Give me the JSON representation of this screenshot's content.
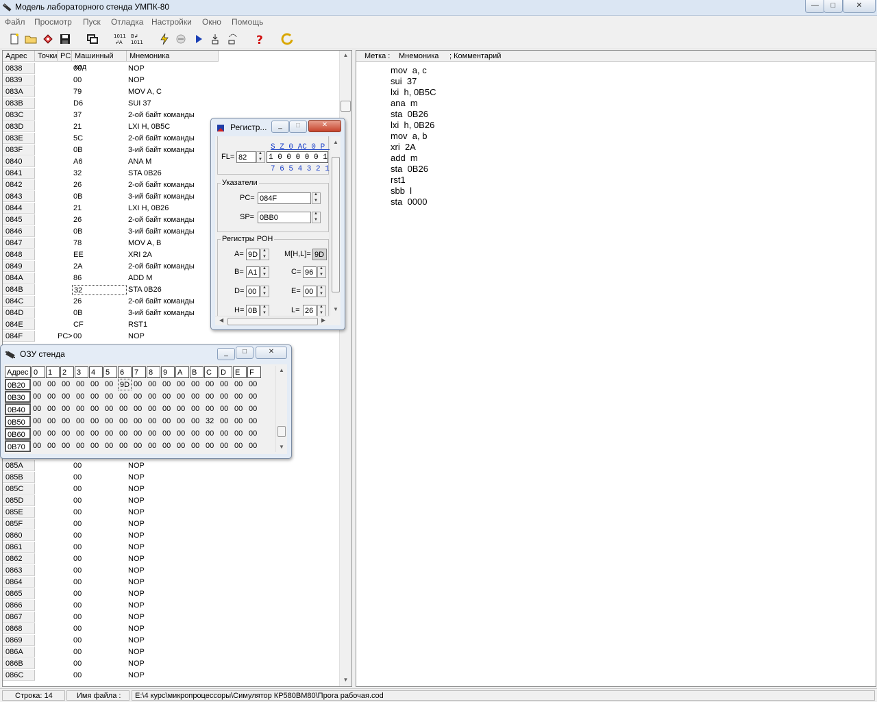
{
  "window": {
    "title": "Модель лабораторного стенда УМПК-80",
    "min": "—",
    "max": "□",
    "close": "✕"
  },
  "menu": [
    "Файл",
    "Просмотр",
    "Пуск",
    "Отладка",
    "Настройки",
    "Окно",
    "Помощь"
  ],
  "code_table": {
    "headers": {
      "addr": "Адрес",
      "breakpoints": "Точки",
      "pc": "PC",
      "machine_code": "Машинный код",
      "mnemonic": "Мнемоника"
    },
    "rows_top": [
      {
        "addr": "0838",
        "pc": "",
        "code": "00",
        "mn": "NOP"
      },
      {
        "addr": "0839",
        "pc": "",
        "code": "00",
        "mn": "NOP"
      },
      {
        "addr": "083A",
        "pc": "",
        "code": "79",
        "mn": "MOV  A, C"
      },
      {
        "addr": "083B",
        "pc": "",
        "code": "D6",
        "mn": "SUI  37"
      },
      {
        "addr": "083C",
        "pc": "",
        "code": "37",
        "mn": "2-ой байт команды"
      },
      {
        "addr": "083D",
        "pc": "",
        "code": "21",
        "mn": "LXI  H, 0B5C"
      },
      {
        "addr": "083E",
        "pc": "",
        "code": "5C",
        "mn": "2-ой байт команды"
      },
      {
        "addr": "083F",
        "pc": "",
        "code": "0B",
        "mn": "3-ий байт команды"
      },
      {
        "addr": "0840",
        "pc": "",
        "code": "A6",
        "mn": "ANA  M"
      },
      {
        "addr": "0841",
        "pc": "",
        "code": "32",
        "mn": "STA  0B26"
      },
      {
        "addr": "0842",
        "pc": "",
        "code": "26",
        "mn": "2-ой байт команды"
      },
      {
        "addr": "0843",
        "pc": "",
        "code": "0B",
        "mn": "3-ий байт команды"
      },
      {
        "addr": "0844",
        "pc": "",
        "code": "21",
        "mn": "LXI  H, 0B26"
      },
      {
        "addr": "0845",
        "pc": "",
        "code": "26",
        "mn": "2-ой байт команды"
      },
      {
        "addr": "0846",
        "pc": "",
        "code": "0B",
        "mn": "3-ий байт команды"
      },
      {
        "addr": "0847",
        "pc": "",
        "code": "78",
        "mn": "MOV  A, B"
      },
      {
        "addr": "0848",
        "pc": "",
        "code": "EE",
        "mn": "XRI  2A"
      },
      {
        "addr": "0849",
        "pc": "",
        "code": "2A",
        "mn": "2-ой байт команды"
      },
      {
        "addr": "084A",
        "pc": "",
        "code": "86",
        "mn": "ADD  M"
      },
      {
        "addr": "084B",
        "pc": "",
        "code": "32",
        "mn": "STA  0B26"
      },
      {
        "addr": "084C",
        "pc": "",
        "code": "26",
        "mn": "2-ой байт команды"
      },
      {
        "addr": "084D",
        "pc": "",
        "code": "0B",
        "mn": "3-ий байт команды"
      },
      {
        "addr": "084E",
        "pc": "",
        "code": "CF",
        "mn": "RST1"
      },
      {
        "addr": "084F",
        "pc": "PC>",
        "code": "00",
        "mn": "NOP"
      }
    ],
    "rows_bottom": [
      {
        "addr": "085A",
        "pc": "",
        "code": "00",
        "mn": "NOP"
      },
      {
        "addr": "085B",
        "pc": "",
        "code": "00",
        "mn": "NOP"
      },
      {
        "addr": "085C",
        "pc": "",
        "code": "00",
        "mn": "NOP"
      },
      {
        "addr": "085D",
        "pc": "",
        "code": "00",
        "mn": "NOP"
      },
      {
        "addr": "085E",
        "pc": "",
        "code": "00",
        "mn": "NOP"
      },
      {
        "addr": "085F",
        "pc": "",
        "code": "00",
        "mn": "NOP"
      },
      {
        "addr": "0860",
        "pc": "",
        "code": "00",
        "mn": "NOP"
      },
      {
        "addr": "0861",
        "pc": "",
        "code": "00",
        "mn": "NOP"
      },
      {
        "addr": "0862",
        "pc": "",
        "code": "00",
        "mn": "NOP"
      },
      {
        "addr": "0863",
        "pc": "",
        "code": "00",
        "mn": "NOP"
      },
      {
        "addr": "0864",
        "pc": "",
        "code": "00",
        "mn": "NOP"
      },
      {
        "addr": "0865",
        "pc": "",
        "code": "00",
        "mn": "NOP"
      },
      {
        "addr": "0866",
        "pc": "",
        "code": "00",
        "mn": "NOP"
      },
      {
        "addr": "0867",
        "pc": "",
        "code": "00",
        "mn": "NOP"
      },
      {
        "addr": "0868",
        "pc": "",
        "code": "00",
        "mn": "NOP"
      },
      {
        "addr": "0869",
        "pc": "",
        "code": "00",
        "mn": "NOP"
      },
      {
        "addr": "086A",
        "pc": "",
        "code": "00",
        "mn": "NOP"
      },
      {
        "addr": "086B",
        "pc": "",
        "code": "00",
        "mn": "NOP"
      },
      {
        "addr": "086C",
        "pc": "",
        "code": "00",
        "mn": "NOP"
      }
    ],
    "selected_addr": "084B"
  },
  "editor": {
    "headers": {
      "label": "Метка :",
      "mnemonic": "Мнемоника",
      "comment": "; Комментарий"
    },
    "lines": [
      "mov  a, c",
      "sui  37",
      "lxi  h, 0B5C",
      "ana  m",
      "sta  0B26",
      "lxi  h, 0B26",
      "mov  a, b",
      "xri  2A",
      "add  m",
      "sta  0B26",
      "rst1",
      "sbb  l",
      "sta  0000"
    ]
  },
  "registers": {
    "title": "Регистр...",
    "flags_label": "FL=",
    "fl_value": "82",
    "flag_names": "S Z 0 AC 0 P 1",
    "flag_bits": "1 0 0 0 0 0 1",
    "bit_numbers": "7 6 5 4 3 2 1",
    "pointers_group": "Указатели",
    "pc_label": "PC=",
    "pc_value": "084F",
    "sp_label": "SP=",
    "sp_value": "0BB0",
    "ron_group": "Регистры РОН",
    "a_label": "A=",
    "a_value": "9D",
    "m_label": "M[H,L]=",
    "m_value": "9D",
    "b_label": "B=",
    "b_value": "A1",
    "c_label": "C=",
    "c_value": "96",
    "d_label": "D=",
    "d_value": "00",
    "e_label": "E=",
    "e_value": "00",
    "h_label": "H=",
    "h_value": "0B",
    "l_label": "L=",
    "l_value": "26"
  },
  "ram": {
    "title": "ОЗУ стенда",
    "addr_header": "Адрес",
    "col_headers": [
      "0",
      "1",
      "2",
      "3",
      "4",
      "5",
      "6",
      "7",
      "8",
      "9",
      "A",
      "B",
      "C",
      "D",
      "E",
      "F"
    ],
    "rows": [
      {
        "addr": "0B20",
        "cells": [
          "00",
          "00",
          "00",
          "00",
          "00",
          "00",
          "9D",
          "00",
          "00",
          "00",
          "00",
          "00",
          "00",
          "00",
          "00",
          "00"
        ]
      },
      {
        "addr": "0B30",
        "cells": [
          "00",
          "00",
          "00",
          "00",
          "00",
          "00",
          "00",
          "00",
          "00",
          "00",
          "00",
          "00",
          "00",
          "00",
          "00",
          "00"
        ]
      },
      {
        "addr": "0B40",
        "cells": [
          "00",
          "00",
          "00",
          "00",
          "00",
          "00",
          "00",
          "00",
          "00",
          "00",
          "00",
          "00",
          "00",
          "00",
          "00",
          "00"
        ]
      },
      {
        "addr": "0B50",
        "cells": [
          "00",
          "00",
          "00",
          "00",
          "00",
          "00",
          "00",
          "00",
          "00",
          "00",
          "00",
          "00",
          "32",
          "00",
          "00",
          "00"
        ]
      },
      {
        "addr": "0B60",
        "cells": [
          "00",
          "00",
          "00",
          "00",
          "00",
          "00",
          "00",
          "00",
          "00",
          "00",
          "00",
          "00",
          "00",
          "00",
          "00",
          "00"
        ]
      },
      {
        "addr": "0B70",
        "cells": [
          "00",
          "00",
          "00",
          "00",
          "00",
          "00",
          "00",
          "00",
          "00",
          "00",
          "00",
          "00",
          "00",
          "00",
          "00",
          "00"
        ]
      }
    ]
  },
  "status": {
    "line": "Строка: 14",
    "file_label": "Имя файла :",
    "file_path": "E:\\4 курс\\микропроцессоры\\Симулятор КР580ВМ80\\Прога рабочая.cod"
  }
}
